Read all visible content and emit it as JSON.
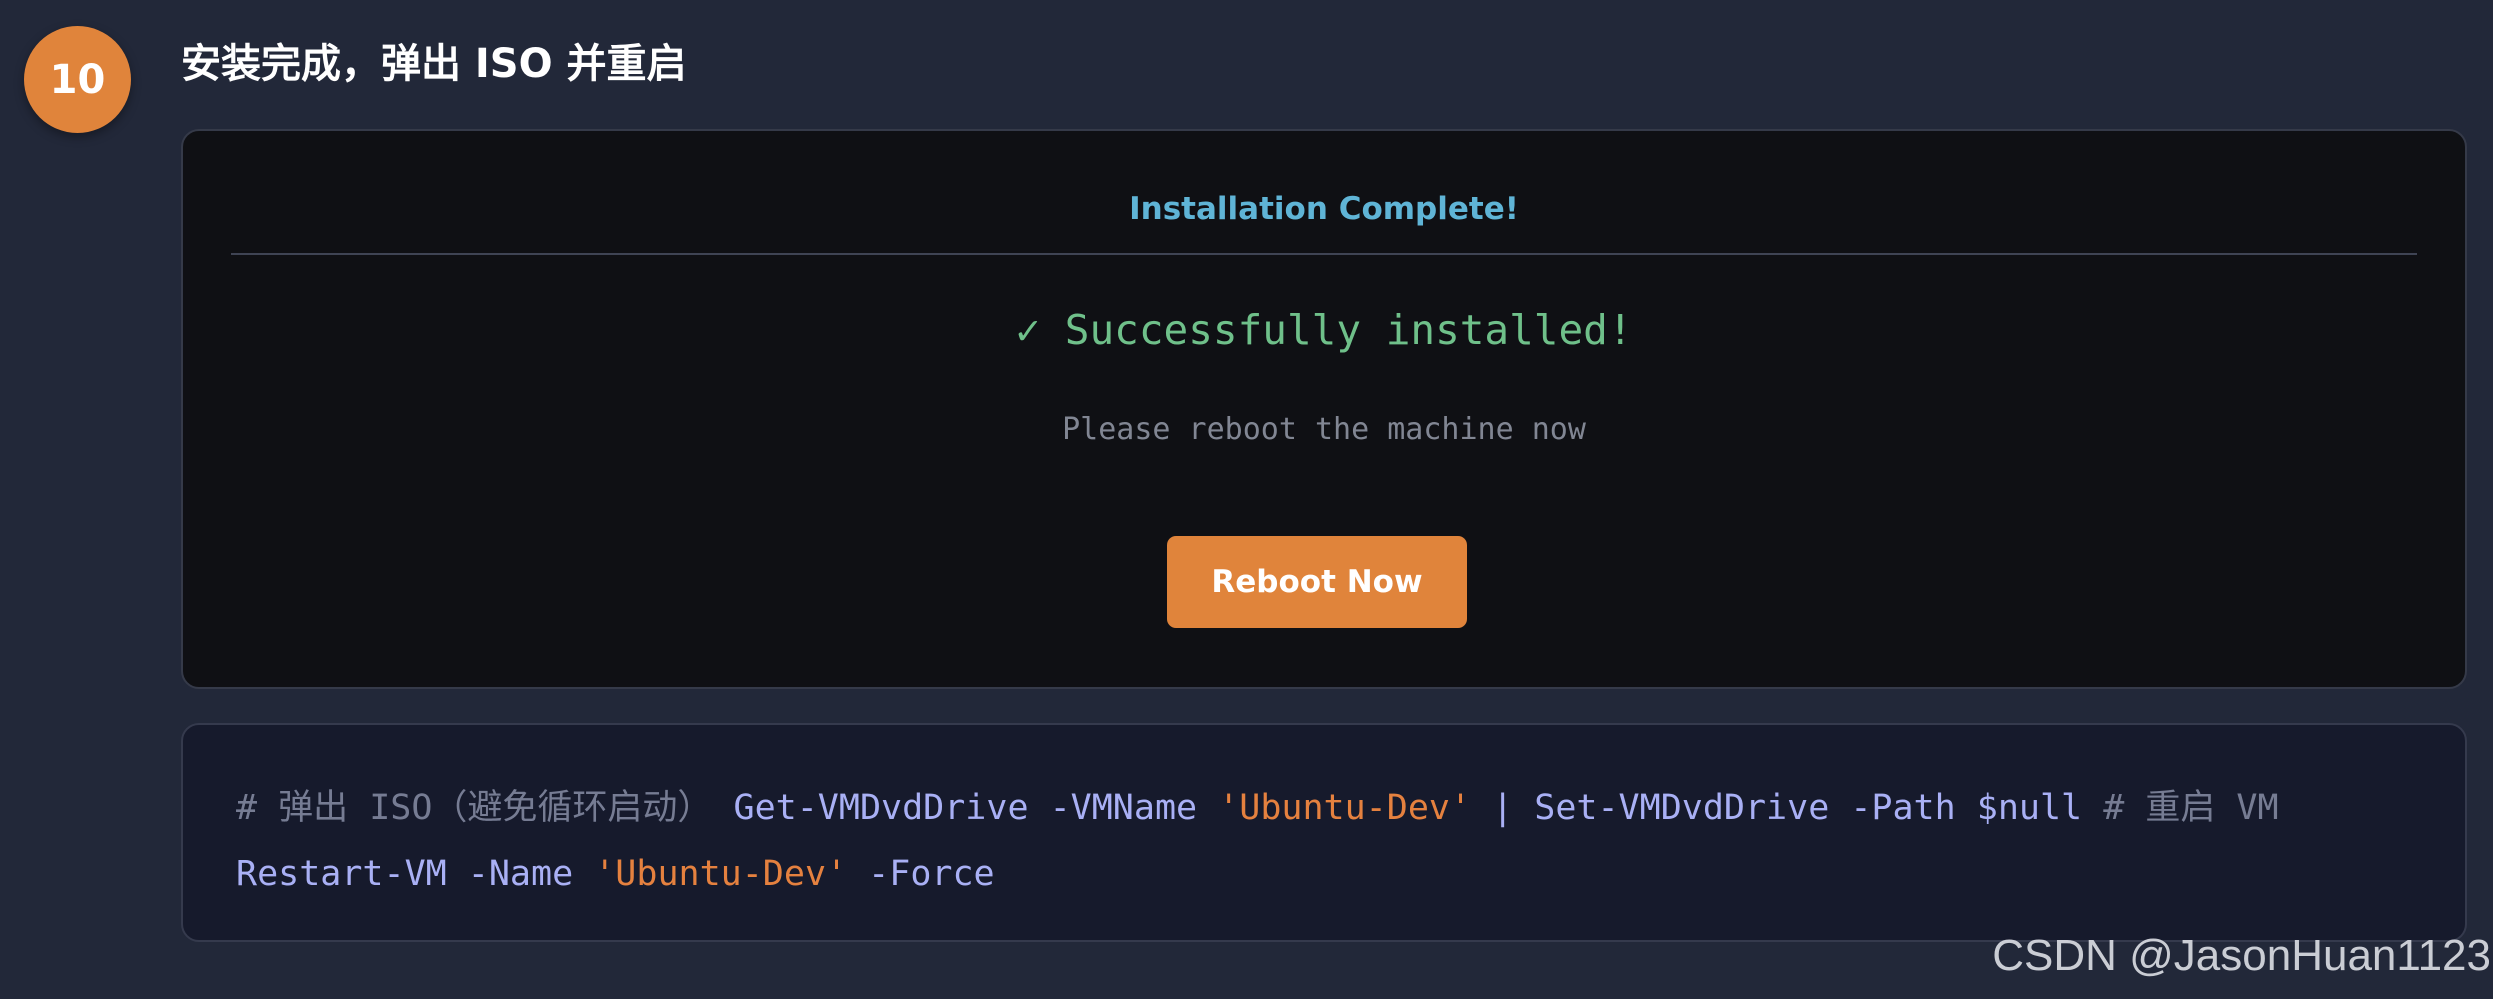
{
  "step": {
    "number": "10",
    "title": "安装完成，弹出 ISO 并重启"
  },
  "terminal": {
    "header": "Installation Complete!",
    "success_message": "✓ Successfully installed!",
    "sub_message": "Please reboot the machine now",
    "reboot_button_label": "Reboot Now"
  },
  "code": {
    "line1": {
      "comment1": "# 弹出 ISO（避免循环启动）",
      "cmd1": " Get-VMDvdDrive -VMName ",
      "string1": "'Ubuntu-Dev'",
      "cmd2": " | Set-VMDvdDrive -Path $null ",
      "comment2": "# 重启 VM"
    },
    "line2": {
      "cmd": "Restart-VM -Name ",
      "string": "'Ubuntu-Dev'",
      "cmd_tail": " -Force"
    }
  },
  "watermark": "CSDN @JasonHuan1123",
  "colors": {
    "accent": "#e0843b",
    "header": "#5fb4d6",
    "success": "#6fc08a",
    "code_string": "#e5813f",
    "code_command": "#a9b0f5"
  }
}
